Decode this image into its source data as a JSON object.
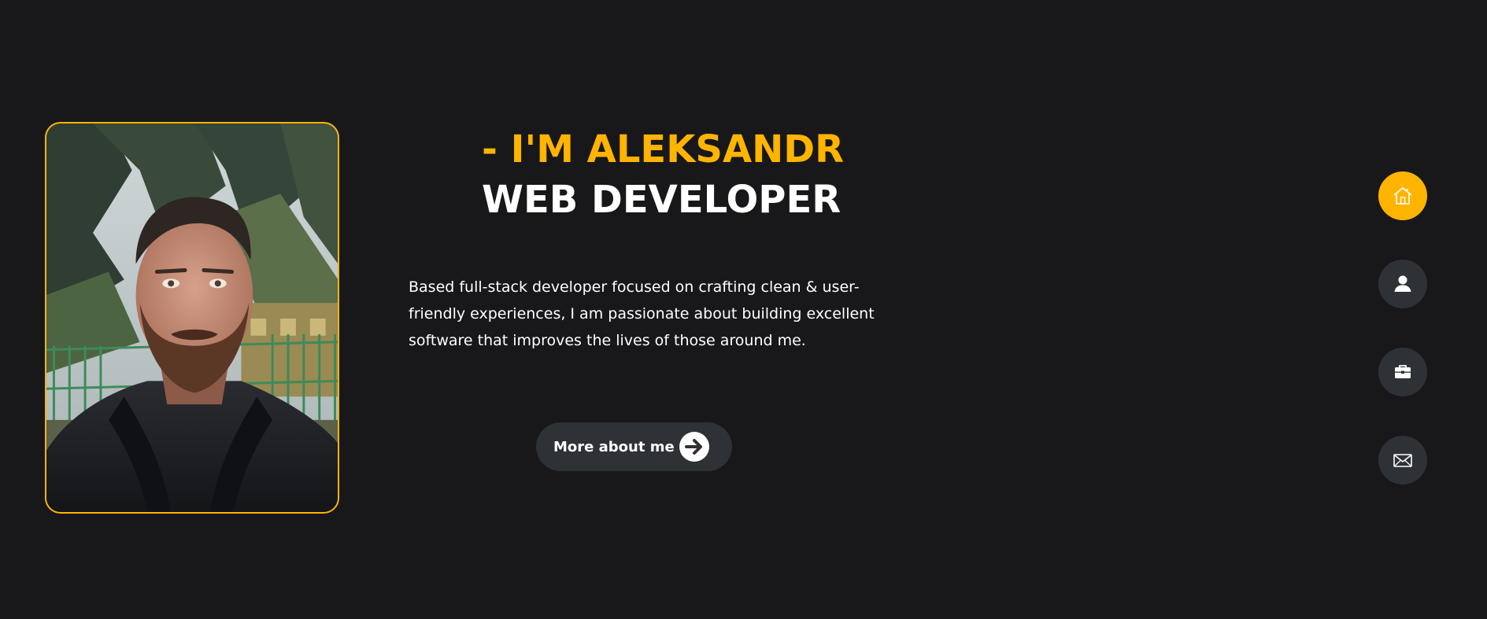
{
  "profile": {
    "photo_icon": "portrait-photo"
  },
  "hero": {
    "greeting": "- I'M ALEKSANDR",
    "role": "WEB DEVELOPER",
    "intro": "Based full-stack developer focused on crafting clean & user-friendly experiences, I am passionate about building excellent software that improves the lives of those around me."
  },
  "cta": {
    "label": "More about me",
    "icon": "arrow-right-circle-icon"
  },
  "nav": {
    "items": [
      {
        "icon": "home-icon",
        "active": true
      },
      {
        "icon": "user-icon",
        "active": false
      },
      {
        "icon": "briefcase-icon",
        "active": false
      },
      {
        "icon": "envelope-icon",
        "active": false
      }
    ]
  },
  "colors": {
    "background": "#18181b",
    "accent": "#ffb400",
    "button": "#2e3135",
    "text": "#ffffff"
  }
}
